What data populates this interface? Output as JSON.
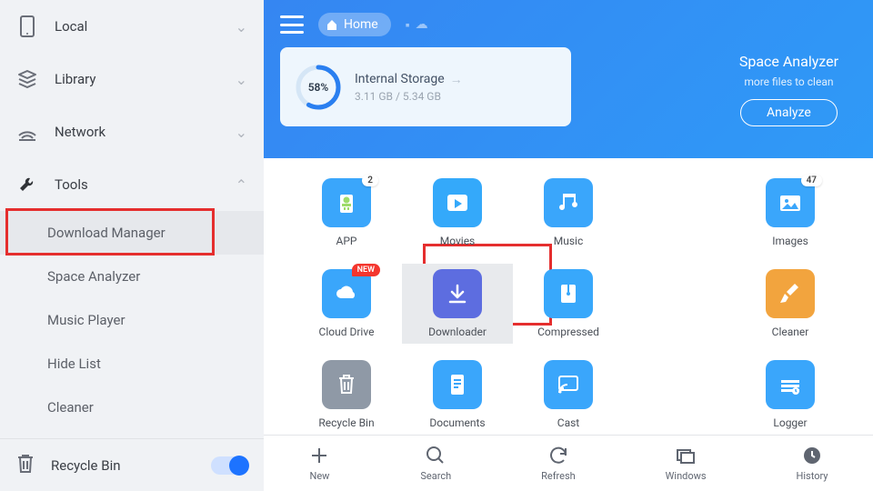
{
  "sidebar": {
    "items": [
      {
        "label": "Local"
      },
      {
        "label": "Library"
      },
      {
        "label": "Network"
      },
      {
        "label": "Tools"
      }
    ],
    "tools_sub": [
      {
        "label": "Download Manager"
      },
      {
        "label": "Space Analyzer"
      },
      {
        "label": "Music Player"
      },
      {
        "label": "Hide List"
      },
      {
        "label": "Cleaner"
      }
    ],
    "recycle_label": "Recycle Bin"
  },
  "header": {
    "home_label": "Home",
    "storage": {
      "percent": "58%",
      "percent_val": 58,
      "name": "Internal Storage",
      "size": "3.11 GB / 5.34 GB"
    },
    "analyzer": {
      "title": "Space Analyzer",
      "sub": "more files to clean",
      "button": "Analyze"
    }
  },
  "grid": [
    {
      "label": "APP",
      "color": "#3aa6fb",
      "icon": "app",
      "badge_num": "2"
    },
    {
      "label": "Movies",
      "color": "#34a9fa",
      "icon": "movies"
    },
    {
      "label": "Music",
      "color": "#3aa6fb",
      "icon": "music"
    },
    {
      "label": "Images",
      "color": "#3aa6fb",
      "icon": "images",
      "badge_num": "47"
    },
    {
      "label": "Cloud Drive",
      "color": "#3aa6fb",
      "icon": "cloud",
      "badge_new": "NEW"
    },
    {
      "label": "Downloader",
      "color": "#5d6de0",
      "icon": "download",
      "selected": true
    },
    {
      "label": "Compressed",
      "color": "#38a8fb",
      "icon": "zip"
    },
    {
      "label": "Cleaner",
      "color": "#f2a43e",
      "icon": "brush"
    },
    {
      "label": "Recycle Bin",
      "color": "#8f99a6",
      "icon": "trash"
    },
    {
      "label": "Documents",
      "color": "#3aa6fb",
      "icon": "doc"
    },
    {
      "label": "Cast",
      "color": "#3aa6fb",
      "icon": "cast"
    },
    {
      "label": "Logger",
      "color": "#3aa6fb",
      "icon": "logger"
    }
  ],
  "bottom": [
    {
      "label": "New",
      "icon": "plus"
    },
    {
      "label": "Search",
      "icon": "search"
    },
    {
      "label": "Refresh",
      "icon": "refresh"
    },
    {
      "label": "Windows",
      "icon": "windows"
    },
    {
      "label": "History",
      "icon": "history"
    }
  ]
}
